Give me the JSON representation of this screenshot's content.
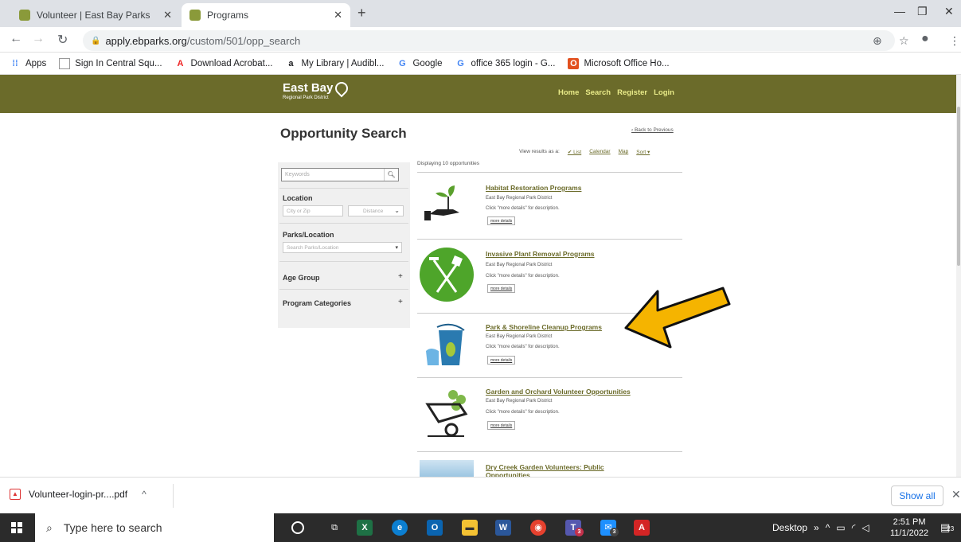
{
  "browser": {
    "tabs": [
      {
        "title": "Volunteer | East Bay Parks",
        "active": false
      },
      {
        "title": "Programs",
        "active": true
      }
    ],
    "url_host": "apply.ebparks.org",
    "url_path": "/custom/501/opp_search",
    "bookmarks": [
      {
        "label": "Apps",
        "icon": "apps-grid-icon"
      },
      {
        "label": "Sign In Central Squ...",
        "icon": "document-icon"
      },
      {
        "label": "Download Acrobat...",
        "icon": "adobe-icon"
      },
      {
        "label": "My Library | Audibl...",
        "icon": "amazon-icon"
      },
      {
        "label": "Google",
        "icon": "google-icon"
      },
      {
        "label": "office 365 login - G...",
        "icon": "google-icon"
      },
      {
        "label": "Microsoft Office Ho...",
        "icon": "office-icon"
      }
    ]
  },
  "site": {
    "logo_name": "East Bay",
    "logo_sub": "Regional Park District",
    "nav": [
      "Home",
      "Search",
      "Register",
      "Login"
    ],
    "header_color": "#6b6b2a"
  },
  "search": {
    "title": "Opportunity Search",
    "back_link": "‹ Back to Previous",
    "view_as_label": "View results as a:",
    "view_options": [
      "✔ List",
      "Calendar",
      "Map",
      "Sort ▾"
    ],
    "displaying": "Displaying 10 opportunities",
    "keywords_placeholder": "Keywords",
    "location_label": "Location",
    "city_placeholder": "City or Zip",
    "distance_placeholder": "Distance",
    "parks_label": "Parks/Location",
    "parks_placeholder": "Search Parks/Location",
    "age_group_label": "Age Group",
    "program_categories_label": "Program Categories"
  },
  "results": [
    {
      "title": "Habitat Restoration Programs",
      "org": "East Bay Regional Park District",
      "desc": "Click \"more details\" for description.",
      "button": "more details"
    },
    {
      "title": "Invasive Plant Removal Programs",
      "org": "East Bay Regional Park District",
      "desc": "Click \"more details\" for description.",
      "button": "more details"
    },
    {
      "title": "Park & Shoreline Cleanup Programs",
      "org": "East Bay Regional Park District",
      "desc": "Click \"more details\" for description.",
      "button": "more details"
    },
    {
      "title": "Garden and Orchard Volunteer Opportunities",
      "org": "East Bay Regional Park District",
      "desc": "Click \"more details\" for description.",
      "button": "more details"
    },
    {
      "title": "Dry Creek Garden Volunteers: Public Opportunities"
    }
  ],
  "download": {
    "file": "Volunteer-login-pr....pdf",
    "show_all": "Show all"
  },
  "taskbar": {
    "search_placeholder": "Type here to search",
    "desktop_label": "Desktop",
    "time": "2:51 PM",
    "date": "11/1/2022",
    "notification_count": "23",
    "teams_badge": "3",
    "mail_badge": "3"
  }
}
